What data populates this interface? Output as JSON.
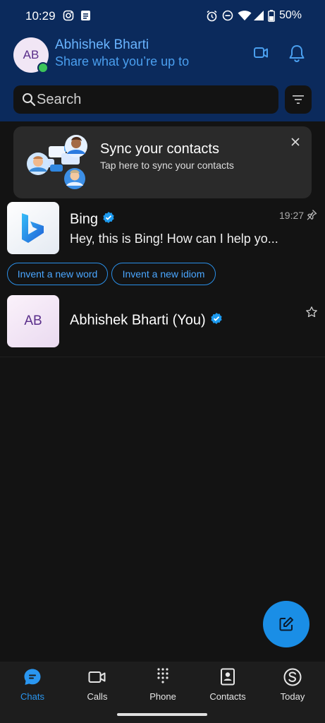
{
  "status_bar": {
    "time": "10:29",
    "battery": "50%",
    "icons": [
      "instagram-icon",
      "notes-icon",
      "alarm-icon",
      "dnd-icon",
      "wifi-icon",
      "signal-icon",
      "battery-icon"
    ]
  },
  "header": {
    "avatar_initials": "AB",
    "name": "Abhishek Bharti",
    "status": "Share what you’re up to",
    "accent_color": "#4a9fef",
    "background_color": "#0b2a5c"
  },
  "search": {
    "placeholder": "Search"
  },
  "sync_card": {
    "title": "Sync your contacts",
    "subtitle": "Tap here to sync your contacts"
  },
  "chats": [
    {
      "name": "Bing",
      "verified": true,
      "message": "Hey, this is Bing! How can I help yo...",
      "time": "19:27",
      "pinned": true,
      "suggestions": [
        "Invent a new word",
        "Invent a new idiom"
      ]
    },
    {
      "name": "Abhishek Bharti (You)",
      "avatar_initials": "AB",
      "verified": true,
      "favorite": false
    }
  ],
  "bottom_nav": {
    "items": [
      {
        "label": "Chats",
        "icon": "chat-icon",
        "active": true
      },
      {
        "label": "Calls",
        "icon": "video-icon",
        "active": false
      },
      {
        "label": "Phone",
        "icon": "dialpad-icon",
        "active": false
      },
      {
        "label": "Contacts",
        "icon": "contacts-icon",
        "active": false
      },
      {
        "label": "Today",
        "icon": "skype-icon",
        "active": false
      }
    ]
  }
}
